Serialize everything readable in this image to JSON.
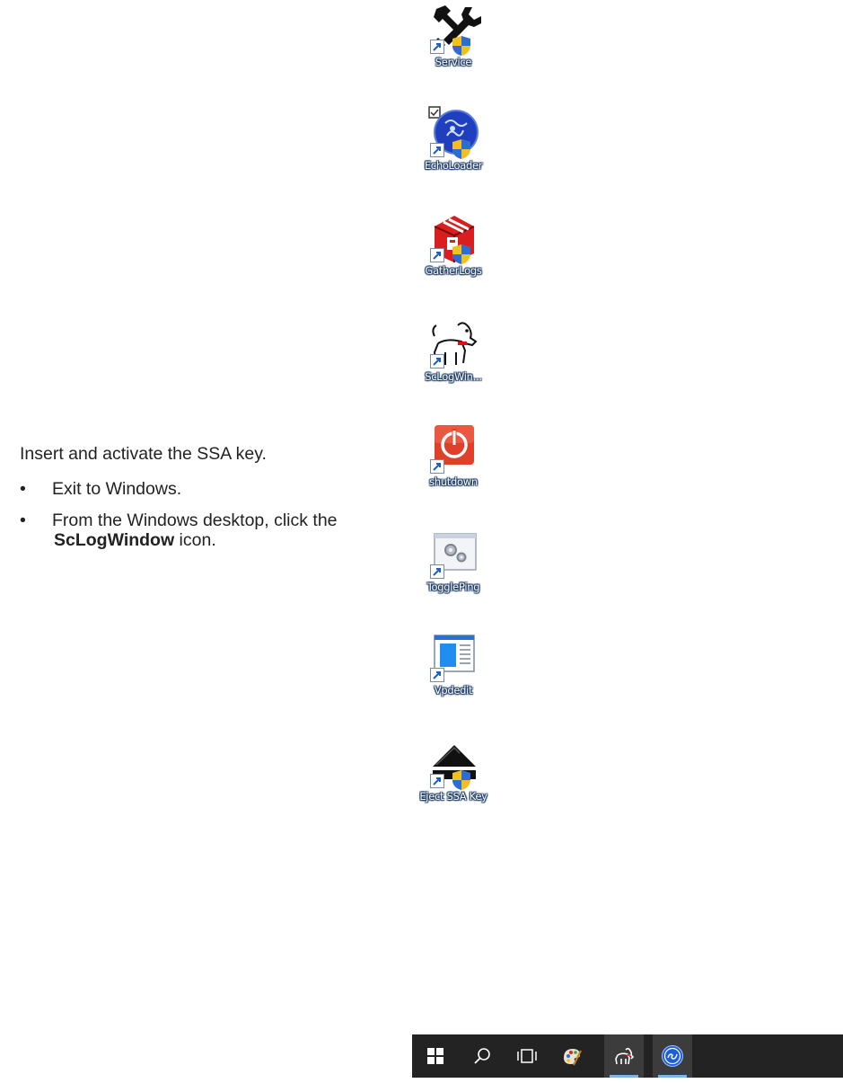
{
  "instructions": {
    "intro": "Insert and activate the SSA key.",
    "steps": [
      {
        "bullet": "•",
        "text": "Exit to Windows."
      },
      {
        "bullet": "•",
        "pre": "From the Windows desktop, click the ",
        "bold": "ScLogWindow",
        "post": " icon."
      }
    ]
  },
  "desktop_icons": [
    {
      "label": "Service",
      "icon": "service-tools-icon"
    },
    {
      "label": "EchoLoader",
      "icon": "echoloader-globe-icon"
    },
    {
      "label": "GatherLogs",
      "icon": "gatherlogs-box-icon"
    },
    {
      "label": "ScLogWin...",
      "icon": "sclogwindow-dog-icon"
    },
    {
      "label": "shutdown",
      "icon": "power-icon"
    },
    {
      "label": "TogglePing",
      "icon": "gears-window-icon"
    },
    {
      "label": "Vpdedit",
      "icon": "document-editor-icon"
    },
    {
      "label": "Eject SSA Key",
      "icon": "eject-icon"
    }
  ],
  "taskbar": {
    "items": [
      {
        "name": "start-button",
        "icon": "windows-logo-icon"
      },
      {
        "name": "search-button",
        "icon": "search-icon"
      },
      {
        "name": "task-view-button",
        "icon": "task-view-icon"
      },
      {
        "name": "paint-app-button",
        "icon": "paint-palette-icon"
      },
      {
        "name": "sclogwindow-app-button",
        "icon": "sclogwindow-dog-icon",
        "active": true
      },
      {
        "name": "ge-app-button",
        "icon": "ge-logo-icon",
        "active": true
      }
    ]
  },
  "colors": {
    "taskbar_bg": "#232323",
    "active_underline": "#7eb4ea",
    "power_red": "#e0402a"
  }
}
